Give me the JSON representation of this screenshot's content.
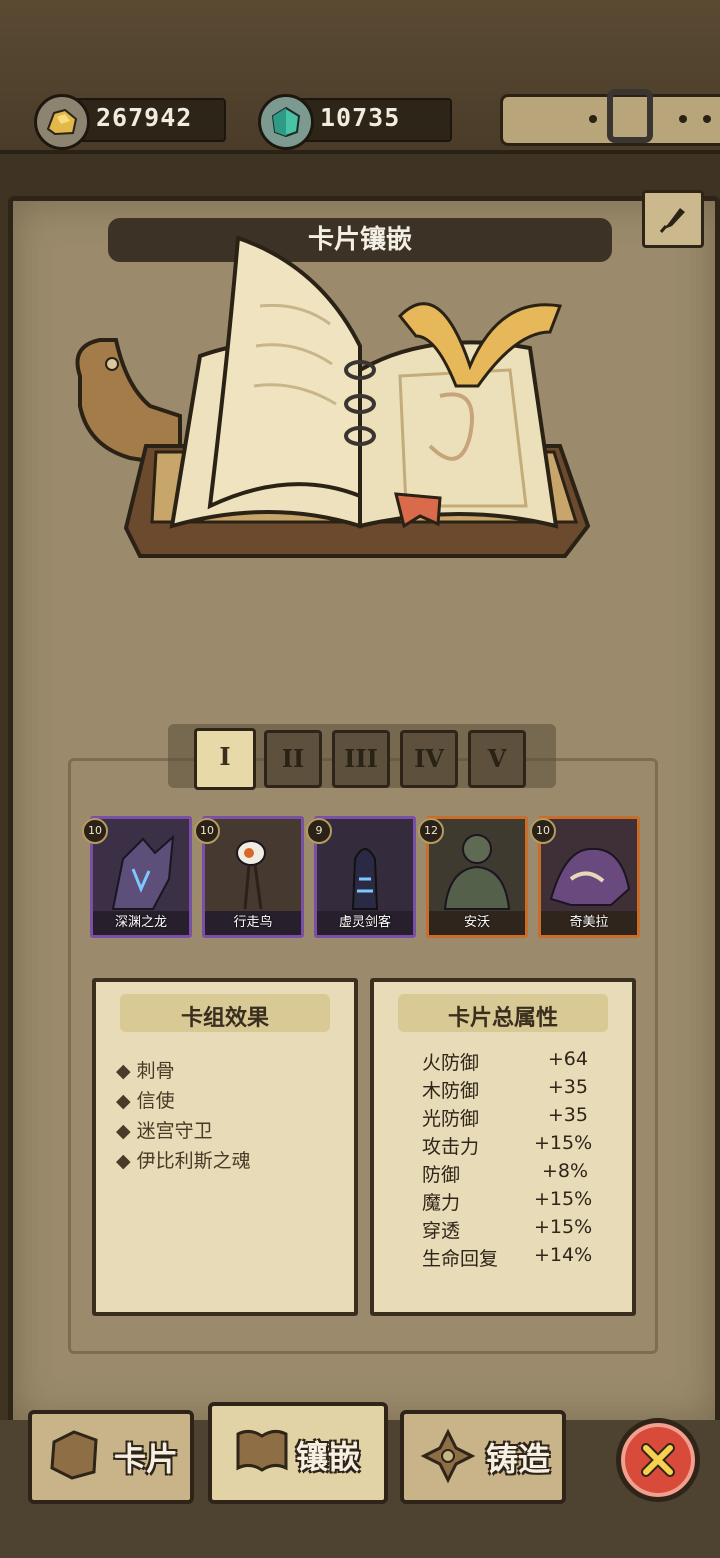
{
  "resources": {
    "gold": "267942",
    "gems": "10735"
  },
  "panel": {
    "title": "卡片镶嵌"
  },
  "tabs": [
    {
      "label": "I",
      "active": true
    },
    {
      "label": "II",
      "active": false
    },
    {
      "label": "III",
      "active": false
    },
    {
      "label": "IV",
      "active": false
    },
    {
      "label": "V",
      "active": false
    }
  ],
  "cards": [
    {
      "name": "深渊之龙",
      "level": "10",
      "rarity": "purple"
    },
    {
      "name": "行走鸟",
      "level": "10",
      "rarity": "purple"
    },
    {
      "name": "虚灵剑客",
      "level": "9",
      "rarity": "purple"
    },
    {
      "name": "安沃",
      "level": "12",
      "rarity": "orange"
    },
    {
      "name": "奇美拉",
      "level": "10",
      "rarity": "orange"
    }
  ],
  "deck_effects": {
    "title": "卡组效果",
    "items": [
      "刺骨",
      "信使",
      "迷宫守卫",
      "伊比利斯之魂"
    ]
  },
  "total_stats": {
    "title": "卡片总属性",
    "items": [
      {
        "name": "火防御",
        "value": "+64"
      },
      {
        "name": "木防御",
        "value": "+35"
      },
      {
        "name": "光防御",
        "value": "+35"
      },
      {
        "name": "攻击力",
        "value": "+15%"
      },
      {
        "name": "防御",
        "value": "+8%"
      },
      {
        "name": "魔力",
        "value": "+15%"
      },
      {
        "name": "穿透",
        "value": "+15%"
      },
      {
        "name": "生命回复",
        "value": "+14%"
      }
    ]
  },
  "nav": {
    "cards": "卡片",
    "inlay": "镶嵌",
    "forge": "铸造"
  },
  "icons": {
    "gold": "gold-ore-icon",
    "gem": "gem-icon",
    "edit": "quill-icon",
    "close": "close-icon"
  }
}
